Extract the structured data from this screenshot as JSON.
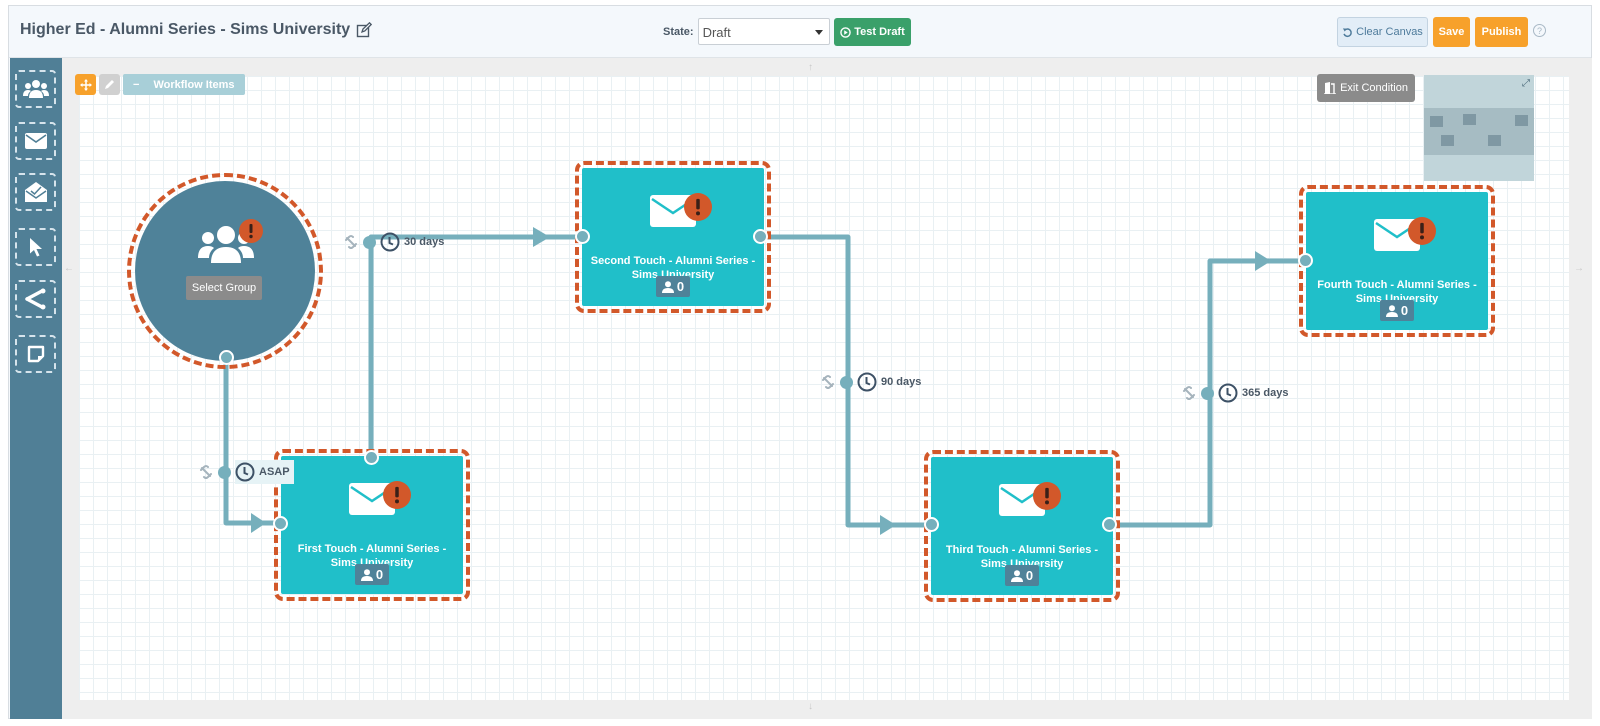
{
  "header": {
    "title": "Higher Ed - Alumni Series - Sims University",
    "edit_icon": "edit-icon",
    "state_label": "State:",
    "state_value": "Draft",
    "test_draft_label": "Test Draft",
    "clear_canvas_label": "Clear Canvas",
    "save_label": "Save",
    "publish_label": "Publish",
    "help_glyph": "?"
  },
  "sidebar": {
    "tools": [
      {
        "name": "group-tool",
        "icon": "users-icon"
      },
      {
        "name": "email-tool",
        "icon": "envelope-icon"
      },
      {
        "name": "email-opened-tool",
        "icon": "envelope-open-icon"
      },
      {
        "name": "click-tool",
        "icon": "cursor-icon"
      },
      {
        "name": "split-tool",
        "icon": "split-icon"
      },
      {
        "name": "note-tool",
        "icon": "sticky-note-icon"
      }
    ]
  },
  "canvas": {
    "workflow_items_label": "Workflow Items",
    "exit_condition_label": "Exit Condition",
    "start_node": {
      "button_label": "Select Group",
      "warning": true
    },
    "nodes": [
      {
        "label": "First Touch - Alumni Series - Sims University",
        "count": "0",
        "warning": true
      },
      {
        "label": "Second Touch - Alumni Series - Sims University",
        "count": "0",
        "warning": true
      },
      {
        "label": "Third Touch - Alumni Series - Sims University",
        "count": "0",
        "warning": true
      },
      {
        "label": "Fourth Touch - Alumni Series - Sims University",
        "count": "0",
        "warning": true
      }
    ],
    "delays": [
      {
        "label": "ASAP"
      },
      {
        "label": "30 days"
      },
      {
        "label": "90 days"
      },
      {
        "label": "365 days"
      }
    ]
  },
  "colors": {
    "accent_orange": "#f7a12b",
    "test_green": "#3aa06a",
    "node_teal": "#20bfc9",
    "sidebar_blue": "#507f96",
    "warning_red": "#d2582a",
    "connector": "#76afbc"
  }
}
